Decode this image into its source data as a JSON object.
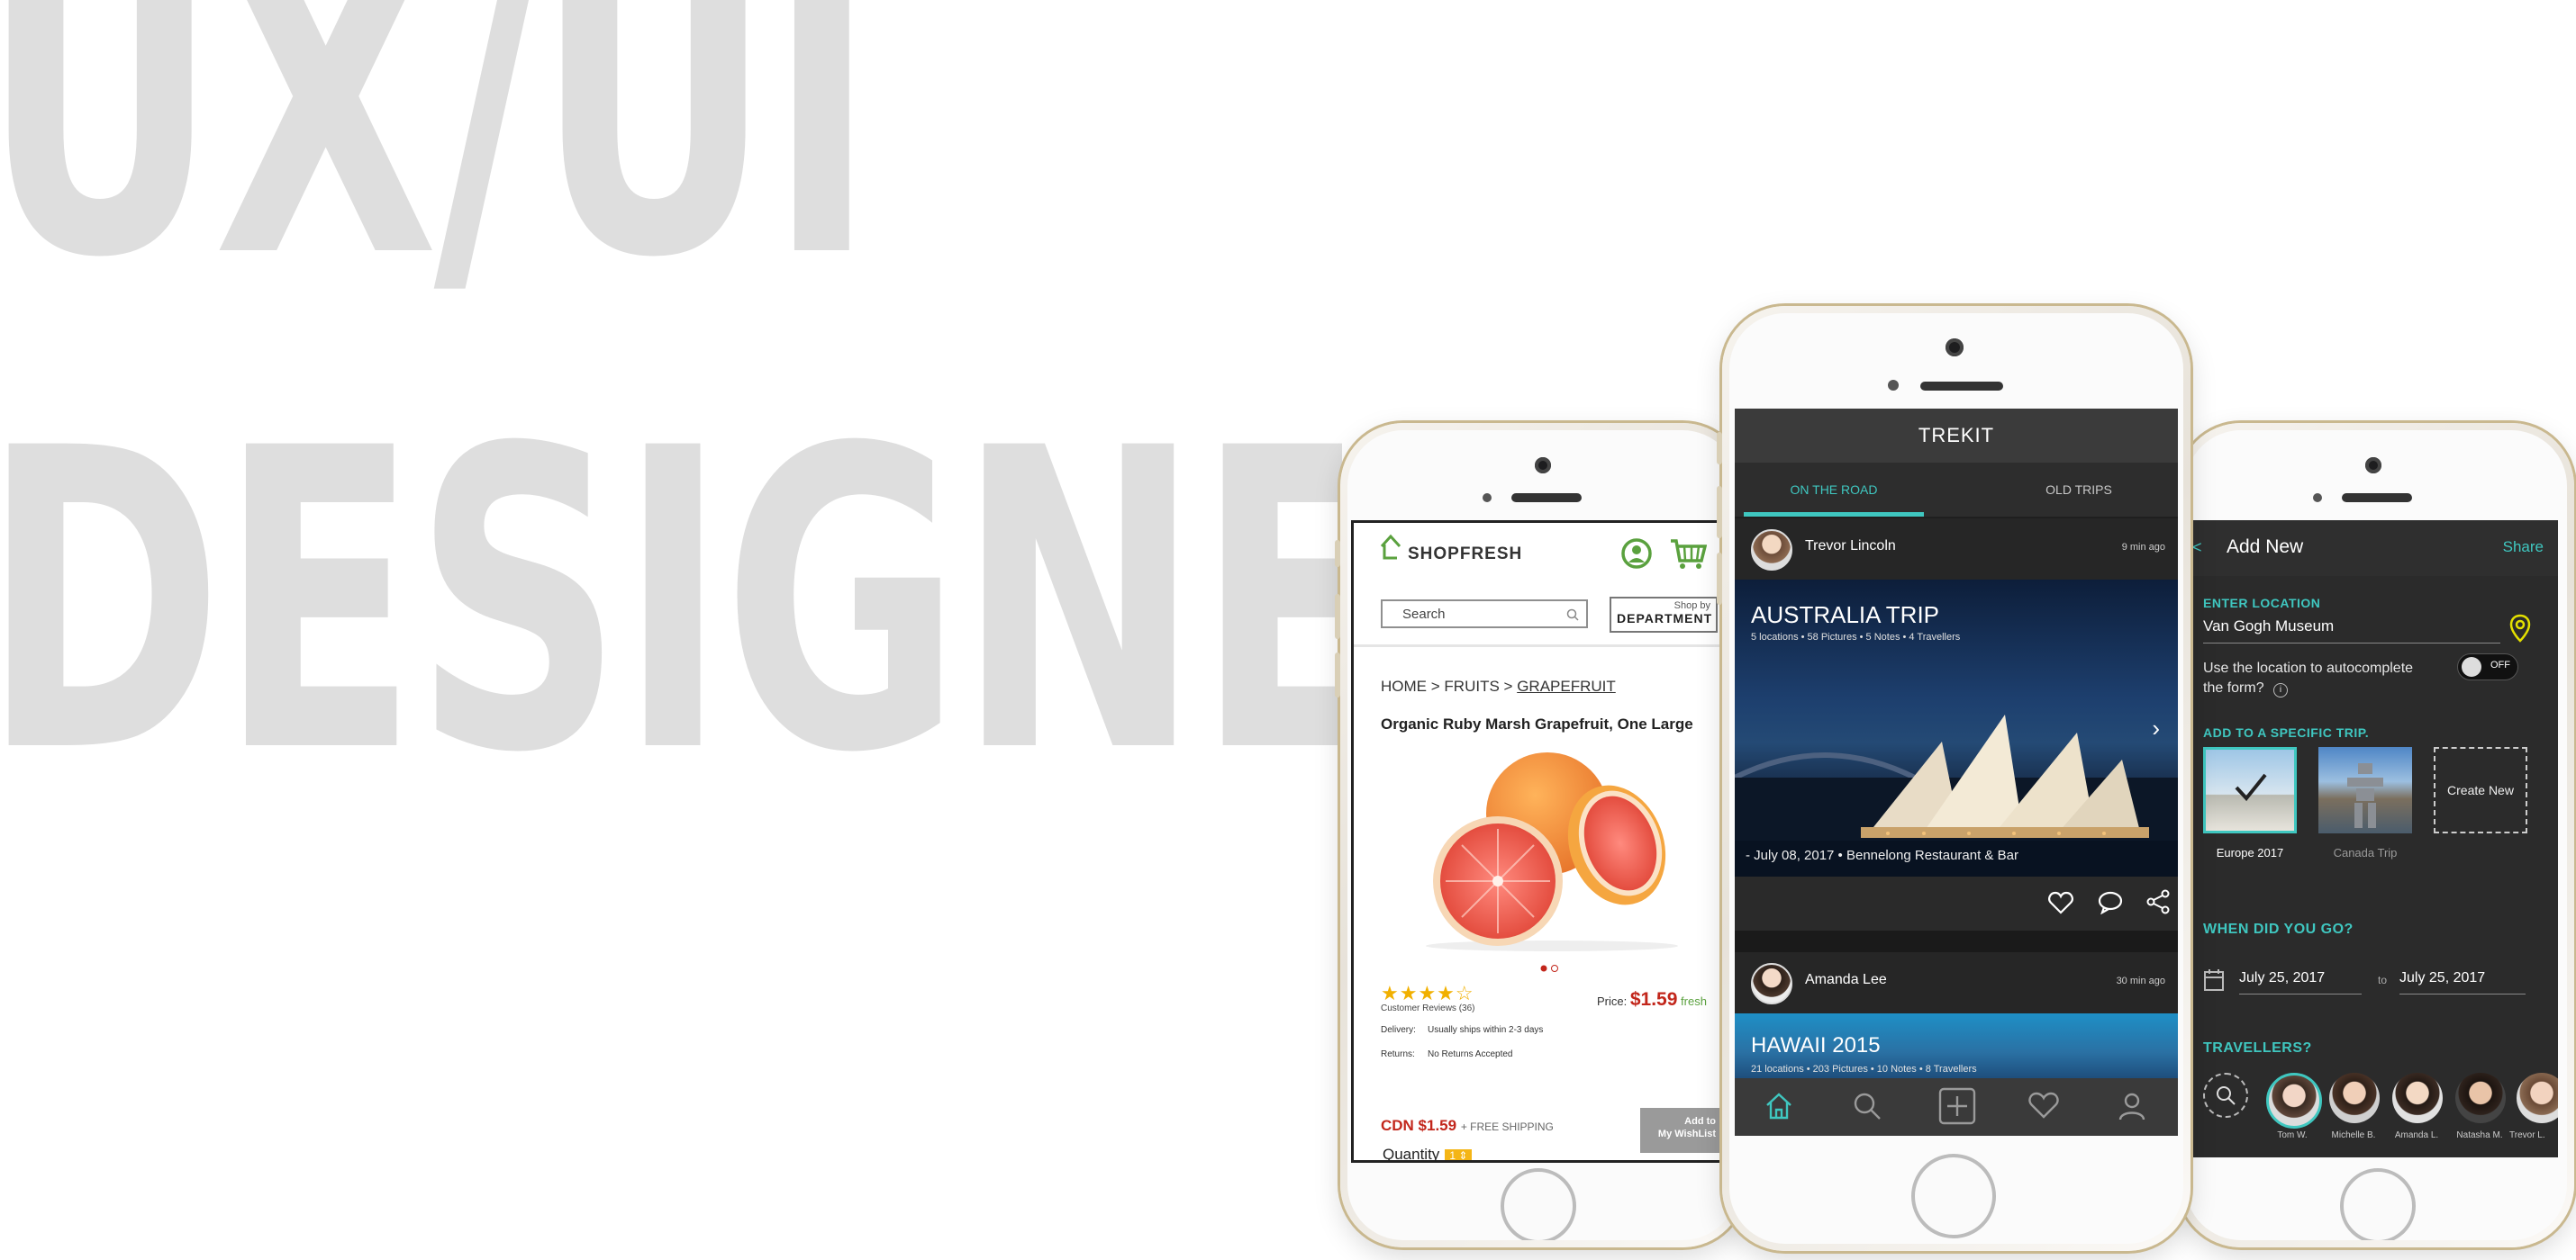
{
  "hero": {
    "line1": "UX/UI",
    "line2": "DESIGNER"
  },
  "colors": {
    "accent_teal": "#3fc7c0",
    "price_red": "#c2261b",
    "fresh_green": "#5aa13e",
    "star_yellow": "#f1b000",
    "hero_gray": "#dedede"
  },
  "shop": {
    "logo": "SHOPFRESH",
    "icons": [
      "account-icon",
      "cart-icon",
      "search-icon",
      "home-logo-icon"
    ],
    "search_placeholder": "Search",
    "dept_small": "Shop by",
    "dept_big": "DEPARTMENT",
    "breadcrumb": {
      "home": "HOME",
      "sep": ">",
      "fruits": "FRUITS",
      "current": "GRAPEFRUIT"
    },
    "product_title": "Organic Ruby Marsh Grapefruit, One Large",
    "rating": {
      "stars_filled": 4,
      "stars_total": 5,
      "reviews_label": "Customer Reviews (36)"
    },
    "price_label": "Price:",
    "price_value": "$1.59",
    "price_tag": "fresh",
    "delivery_key": "Delivery:",
    "delivery_val": "Usually ships within 2-3 days",
    "returns_key": "Returns:",
    "returns_val": "No Returns Accepted",
    "cdn_price": "CDN $1.59",
    "shipping": "+ FREE SHIPPING",
    "wishlist_line1": "Add to",
    "wishlist_line2": "My WishList",
    "quantity_label": "Quantity",
    "quantity_value": "1"
  },
  "trekit": {
    "app_title": "TREKIT",
    "tabs": [
      {
        "label": "ON THE ROAD",
        "active": true
      },
      {
        "label": "OLD TRIPS",
        "active": false
      }
    ],
    "posts": [
      {
        "user": "Trevor Lincoln",
        "time": "9 min ago",
        "trip_title": "AUSTRALIA TRIP",
        "trip_meta": "5 locations • 58 Pictures • 5 Notes • 4 Travellers",
        "footer": "- July 08, 2017 • Bennelong Restaurant & Bar"
      },
      {
        "user": "Amanda Lee",
        "time": "30 min ago",
        "trip_title": "HAWAII 2015",
        "trip_meta": "21 locations • 203 Pictures • 10 Notes • 8 Travellers"
      }
    ],
    "action_icons": [
      "heart-icon",
      "comment-icon",
      "share-icon"
    ],
    "nav_icons": [
      "home-icon",
      "search-icon",
      "add-icon",
      "heart-icon",
      "profile-icon"
    ]
  },
  "addnew": {
    "back": "<",
    "title": "Add New",
    "share": "Share",
    "enter_location_label": "ENTER LOCATION",
    "location_value": "Van Gogh Museum",
    "autocomplete_line1": "Use the location to autocomplete",
    "autocomplete_line2": "the form?",
    "toggle_label": "OFF",
    "add_trip_label": "ADD TO A SPECIFIC TRIP.",
    "trips": [
      {
        "name": "Europe 2017",
        "selected": true
      },
      {
        "name": "Canada Trip",
        "selected": false
      }
    ],
    "create_new": "Create New",
    "when_label": "WHEN DID YOU GO?",
    "date_from": "July 25, 2017",
    "date_to_word": "to",
    "date_to": "July 25, 2017",
    "travellers_label": "TRAVELLERS?",
    "travellers": [
      "Tom W.",
      "Michelle B.",
      "Amanda L.",
      "Natasha M.",
      "Trevor L."
    ]
  }
}
